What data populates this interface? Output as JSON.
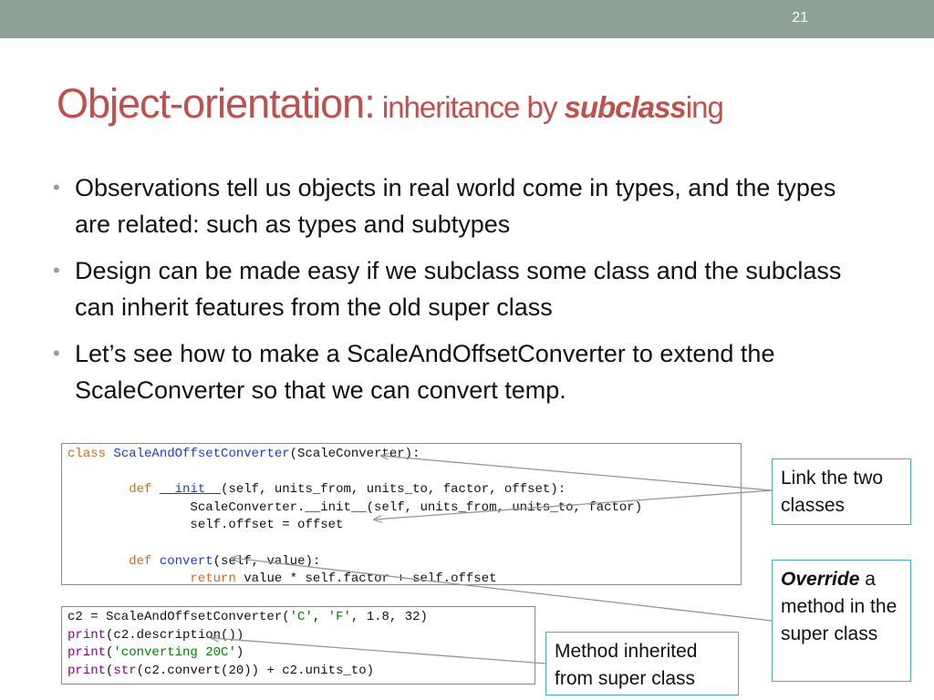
{
  "slide": {
    "number": "21",
    "topbar_color": "#8fa196",
    "title_color": "#c0504d",
    "callout_border_color": "#4bacc6"
  },
  "title": {
    "main": "Object-orientation:",
    "sub": " inheritance by ",
    "emphasis": "subclass",
    "suffix": "ing"
  },
  "bullets": [
    {
      "text": "Observations tell us objects in real world come in types, and the types are related: such as types and subtypes"
    },
    {
      "text": "Design can be made easy if we subclass some class and the subclass can inherit features from the old super class"
    },
    {
      "text": "Let’s see how to make a ScaleAndOffsetConverter to extend the ScaleConverter so that we can convert temp."
    }
  ],
  "code_class": {
    "l1_kw": "class",
    "l1_name": "ScaleAndOffsetConverter",
    "l1_rest": "(ScaleConverter):",
    "l3_kw": "def",
    "l3_fn": "__init__",
    "l3_rest": "(self, units_from, units_to, factor, offset):",
    "l4": "ScaleConverter.__init__(self, units_from, units_to, factor)",
    "l5": "self.offset = offset",
    "l7_kw": "def",
    "l7_fn": "convert",
    "l7_rest": "(self, value):",
    "l8_kw": "return",
    "l8_rest": " value * self.factor + self.offset"
  },
  "code_usage": {
    "l1_a": "c2 = ScaleAndOffsetConverter(",
    "l1_s1": "'C'",
    "l1_b": ", ",
    "l1_s2": "'F'",
    "l1_c": ", 1.8, 32)",
    "print_kw": "print",
    "l2_rest": "(c2.description())",
    "l3_a": "(",
    "l3_s": "'converting 20C'",
    "l3_b": ")",
    "l4_str": "str",
    "l4_rest": "(c2.convert(20)) + c2.units_to)",
    "l4_open": "("
  },
  "callouts": {
    "link": "Link the two classes",
    "override_em": "Override",
    "override_rest": " a method in the super class",
    "inherited": "Method inherited from super class"
  }
}
